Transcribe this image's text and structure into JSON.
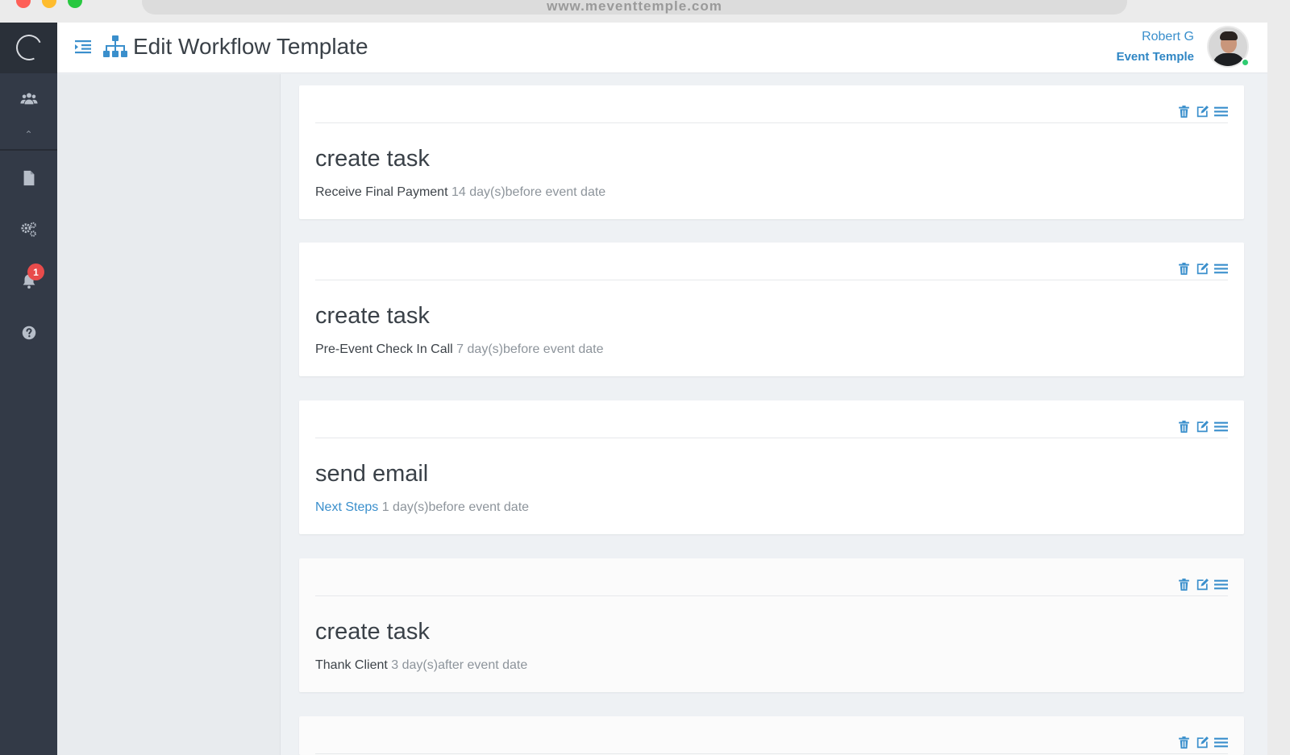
{
  "browser": {
    "url": "www.meventtemple.com"
  },
  "header": {
    "title": "Edit Workflow Template",
    "user_name": "Robert G",
    "user_org": "Event Temple"
  },
  "sidebar": {
    "notification_count": "1",
    "items": [
      {
        "icon": "users-icon"
      },
      {
        "icon": "document-icon"
      },
      {
        "icon": "gears-icon"
      },
      {
        "icon": "bell-icon"
      },
      {
        "icon": "help-icon"
      }
    ]
  },
  "colors": {
    "accent": "#3a8fcc",
    "sidebar": "#333a47",
    "badge": "#e84b4b"
  },
  "steps": [
    {
      "title": "create task",
      "name": "Receive Final Payment",
      "timing": " 14 day(s)before event date",
      "name_is_link": false
    },
    {
      "title": "create task",
      "name": "Pre-Event Check In Call",
      "timing": " 7 day(s)before event date",
      "name_is_link": false
    },
    {
      "title": "send email",
      "name": "Next Steps",
      "timing": " 1 day(s)before event date",
      "name_is_link": true
    },
    {
      "title": "create task",
      "name": "Thank Client",
      "timing": " 3 day(s)after event date",
      "name_is_link": false
    }
  ]
}
